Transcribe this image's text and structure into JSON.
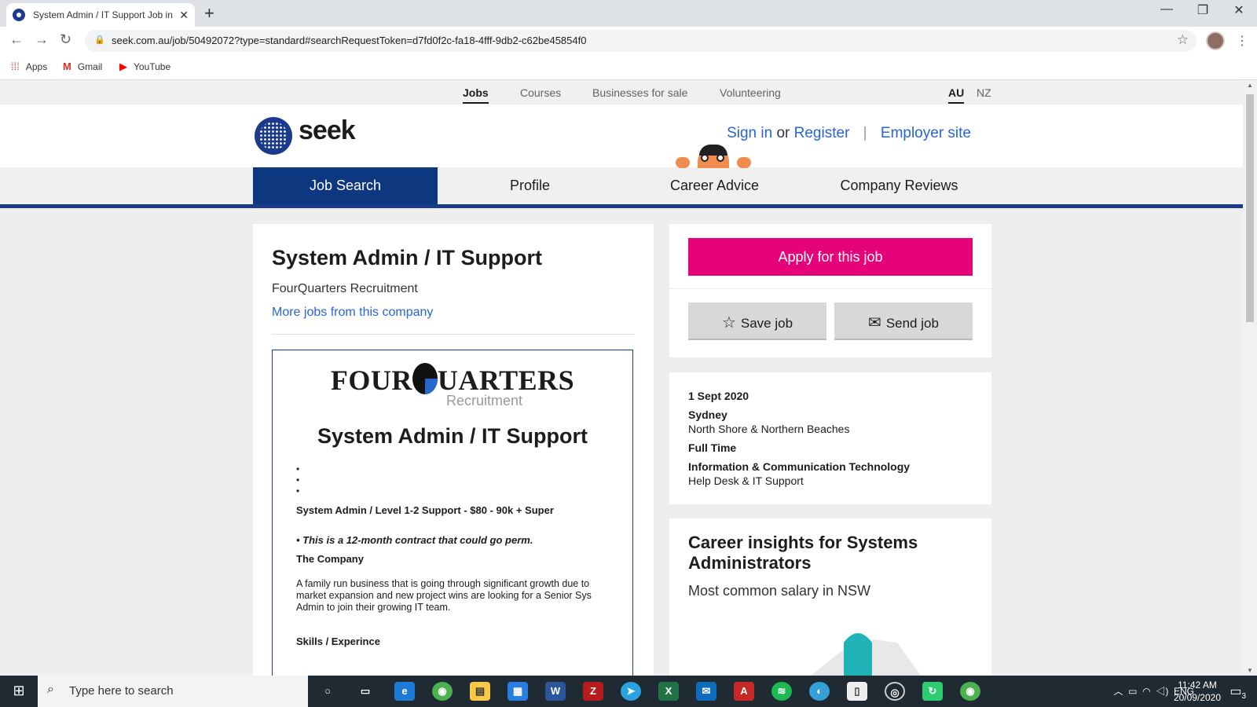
{
  "browser": {
    "tab_title": "System Admin / IT Support Job in",
    "url": "seek.com.au/job/50492072?type=standard#searchRequestToken=d7fd0f2c-fa18-4fff-9db2-c62be45854f0",
    "bookmarks": [
      "Apps",
      "Gmail",
      "YouTube"
    ]
  },
  "sitebar": {
    "items": [
      "Jobs",
      "Courses",
      "Businesses for sale",
      "Volunteering"
    ],
    "locales": [
      "AU",
      "NZ"
    ]
  },
  "header": {
    "logo": "seek",
    "sign_in": "Sign in",
    "or": "or",
    "register": "Register",
    "sep": "|",
    "employer": "Employer site"
  },
  "mainnav": {
    "items": [
      "Job Search",
      "Profile",
      "Career Advice",
      "Company Reviews"
    ]
  },
  "job": {
    "title": "System Admin / IT Support",
    "company": "FourQuarters Recruitment",
    "more_jobs": "More jobs from this company",
    "ad": {
      "logo_left": "FOUR",
      "logo_right": "UARTERS",
      "logo_sub": "Recruitment",
      "title": "System Admin / IT Support",
      "salary_line": "System Admin / Level 1-2 Support - $80 - 90k + Super",
      "contract": "This is a 12-month contract that could go perm.",
      "company_heading": "The Company",
      "company_text": "A family run business that is going through significant growth due to market expansion and new project wins are looking for a Senior Sys Admin to join their growing IT team.",
      "skills_heading": "Skills / Experince"
    }
  },
  "actions": {
    "apply": "Apply for this job",
    "save": "Save job",
    "send": "Send job"
  },
  "meta": {
    "date": "1 Sept 2020",
    "location": "Sydney",
    "area": "North Shore & Northern Beaches",
    "work_type": "Full Time",
    "classification": "Information & Communication Technology",
    "subclass": "Help Desk & IT Support"
  },
  "insights": {
    "title": "Career insights for Systems Administrators",
    "subtitle": "Most common salary in NSW"
  },
  "colors": {
    "brand_blue": "#0d3880",
    "apply_pink": "#e60278",
    "link_blue": "#2765cf"
  },
  "taskbar": {
    "search_placeholder": "Type here to search",
    "lang": "ENG",
    "time": "11:42 AM",
    "date": "20/09/2020",
    "notif_count": "3"
  }
}
